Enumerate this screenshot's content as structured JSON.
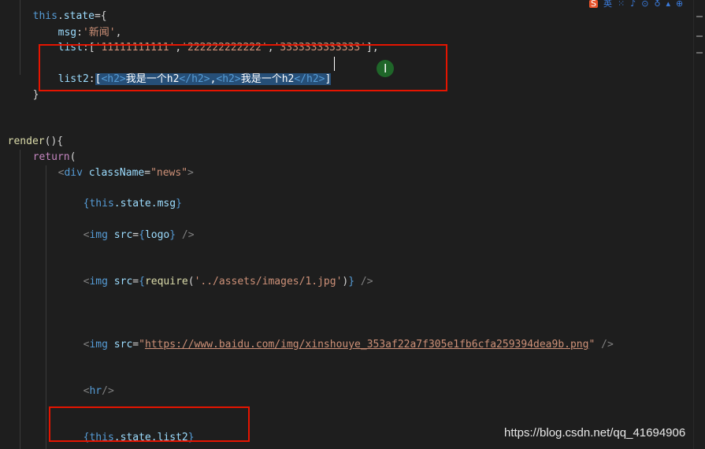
{
  "code": {
    "l0_this": "this",
    "l0_dot": ".",
    "l0_state": "state",
    "l0_eq": "={",
    "l1_msg": "msg",
    "l1_colon": ":",
    "l1_val": "'新闻'",
    "l1_comma": ",",
    "l2_list": "list",
    "l2_open": ":[",
    "l2_s1": "'11111111111'",
    "l2_c1": ",",
    "l2_s2": "'222222222222'",
    "l2_c2": ",",
    "l2_s3": "'3333333333333'",
    "l2_close": "],",
    "l3_list2": "list2",
    "l3_colon": ":",
    "l3_sel": {
      "open": "[",
      "t1o": "<h2>",
      "x1": "我是一个h2",
      "t1c": "</h2>",
      "comma": ",",
      "t2o": "<h2>",
      "x2": "我是一个h2",
      "t2c": "</h2>",
      "close": "]"
    },
    "l4_brace": "}",
    "l5_render": "render",
    "l5_parens": "(){",
    "l6_return": "return",
    "l6_paren": "(",
    "l7_lt": "<",
    "l7_div": "div",
    "l7_cn": "className",
    "l7_eq": "=",
    "l7_val": "\"news\"",
    "l7_gt": ">",
    "l8_ob": "{",
    "l8_expr_this": "this",
    "l8_expr_rest": ".state.msg",
    "l8_cb": "}",
    "l9_lt": "<",
    "l9_img": "img",
    "l9_src": "src",
    "l9_eq": "=",
    "l9_ob": "{",
    "l9_logo": "logo",
    "l9_cb": "}",
    "l9_end": " />",
    "l10_lt": "<",
    "l10_img": "img",
    "l10_src": "src",
    "l10_eq": "=",
    "l10_ob": "{",
    "l10_req": "require",
    "l10_op": "(",
    "l10_path": "'../assets/images/1.jpg'",
    "l10_cp": ")",
    "l10_cb": "}",
    "l10_end": " />",
    "l11_lt": "<",
    "l11_img": "img",
    "l11_src": "src",
    "l11_eq": "=",
    "l11_q1": "\"",
    "l11_url": "https://www.baidu.com/img/xinshouye_353af22a7f305e1fb6cfa259394dea9b.png",
    "l11_q2": "\"",
    "l11_end": " />",
    "l12_lt": "<",
    "l12_hr": "hr",
    "l12_end": "/>",
    "l13_ob": "{",
    "l13_this": "this",
    "l13_rest": ".state.list2",
    "l13_cb": "}"
  },
  "top_icons": [
    "S",
    "英",
    "⁙",
    "♪",
    "⊙",
    "♁",
    "▴",
    "⊕"
  ],
  "watermark": "https://blog.csdn.net/qq_41694906",
  "colors": {
    "background": "#1e1e1e",
    "highlight_box": "#e51400",
    "selection": "#264f78"
  }
}
